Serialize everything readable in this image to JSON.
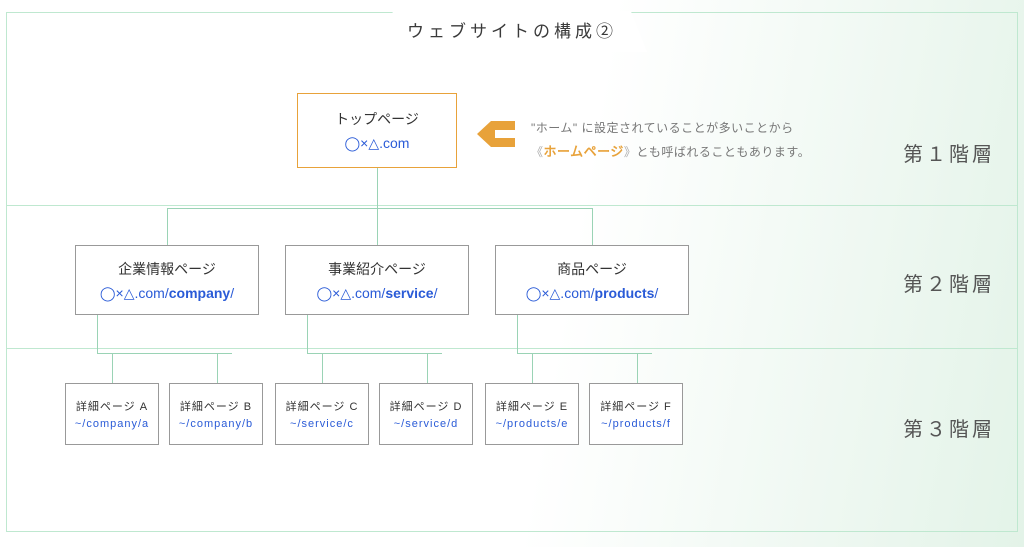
{
  "title": "ウェブサイトの構成②",
  "layers": {
    "l1": "第１階層",
    "l2": "第２階層",
    "l3": "第３階層"
  },
  "top": {
    "title": "トップページ",
    "url": "◯×△.com"
  },
  "annotation": {
    "line1_a": "\"ホーム\" に設定されていることが多いことから",
    "bracket_open": "《",
    "hp": "ホームページ",
    "bracket_close": "》",
    "line2_b": "とも呼ばれることもあります。"
  },
  "level2": {
    "company": {
      "title": "企業情報ページ",
      "url_prefix": "◯×△.com/",
      "slug": "company",
      "url_suffix": "/"
    },
    "service": {
      "title": "事業紹介ページ",
      "url_prefix": "◯×△.com/",
      "slug": "service",
      "url_suffix": "/"
    },
    "products": {
      "title": "商品ページ",
      "url_prefix": "◯×△.com/",
      "slug": "products",
      "url_suffix": "/"
    }
  },
  "level3": {
    "a": {
      "title": "詳細ページ  A",
      "url": "~/company/a"
    },
    "b": {
      "title": "詳細ページ  B",
      "url": "~/company/b"
    },
    "c": {
      "title": "詳細ページ  C",
      "url": "~/service/c"
    },
    "d": {
      "title": "詳細ページ  D",
      "url": "~/service/d"
    },
    "e": {
      "title": "詳細ページ  E",
      "url": "~/products/e"
    },
    "f": {
      "title": "詳細ページ  F",
      "url": "~/products/f"
    }
  }
}
